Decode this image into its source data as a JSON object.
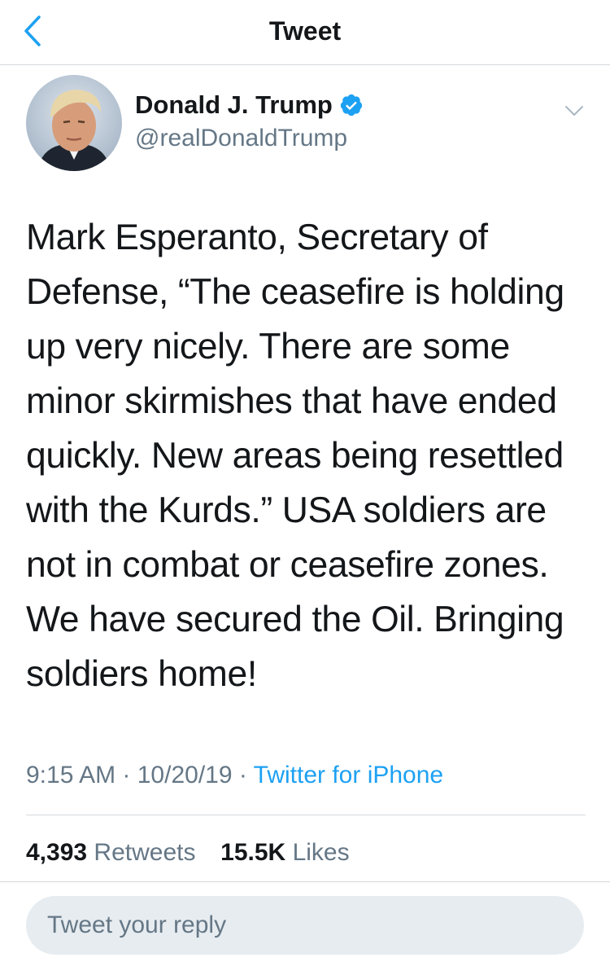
{
  "nav": {
    "title": "Tweet",
    "back_icon": "chevron-left-icon"
  },
  "author": {
    "display_name": "Donald J. Trump",
    "handle": "@realDonaldTrump",
    "verified_icon": "verified-badge-icon",
    "menu_icon": "chevron-down-icon"
  },
  "tweet": {
    "text": "Mark Esperanto, Secretary of Defense, “The ceasefire is holding up very nicely. There are some minor skirmishes that have ended quickly. New areas being resettled with the Kurds.” USA soldiers are not in combat or ceasefire zones. We have secured the Oil. Bringing soldiers home!",
    "time": "9:15 AM",
    "date": "10/20/19",
    "source": "Twitter for iPhone"
  },
  "stats": {
    "retweets_count": "4,393",
    "retweets_label": "Retweets",
    "likes_count": "15.5K",
    "likes_label": "Likes"
  },
  "reply": {
    "placeholder": "Tweet your reply"
  },
  "colors": {
    "accent": "#1da1f2",
    "text": "#14171a",
    "secondary": "#657786",
    "divider": "#d6d9dc",
    "reply_bg": "#e6ecf0"
  }
}
